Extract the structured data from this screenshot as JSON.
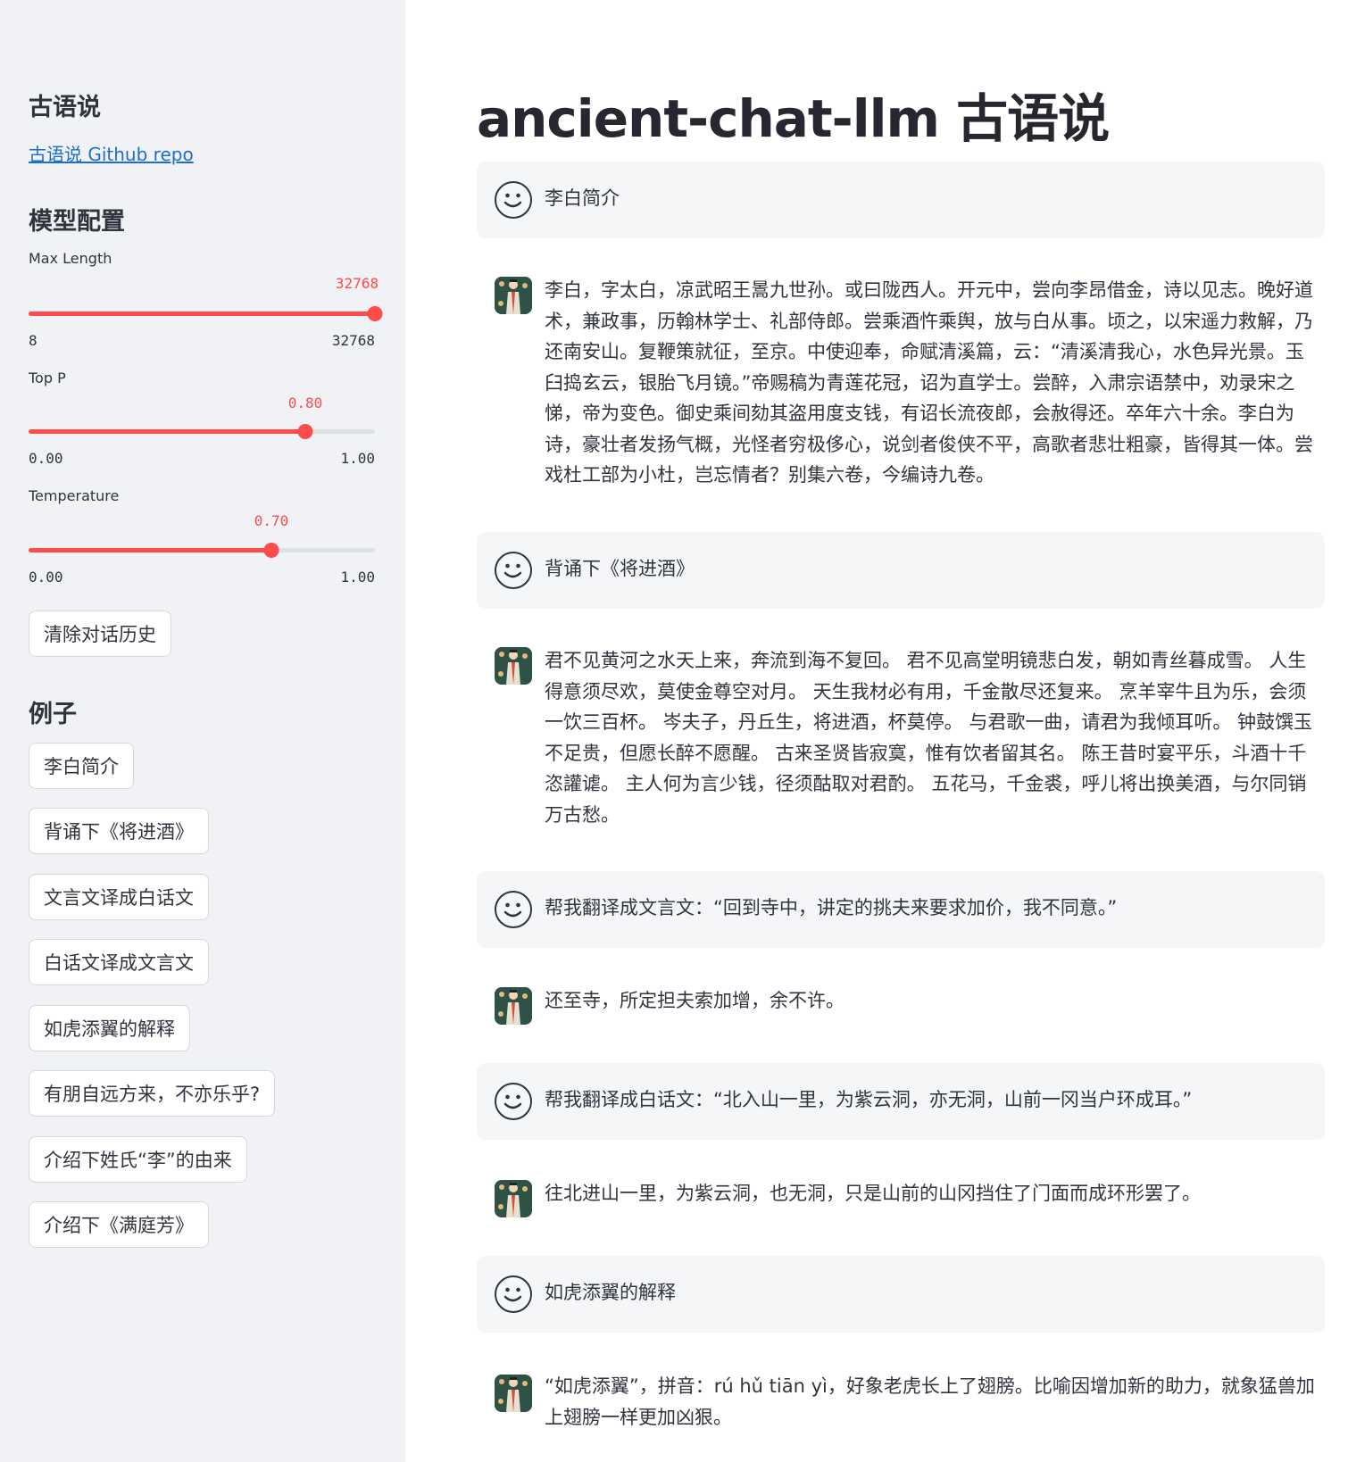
{
  "sidebar": {
    "title": "古语说",
    "repo_link": "古语说 Github repo",
    "model_config_heading": "模型配置",
    "sliders": [
      {
        "label": "Max Length",
        "value": "32768",
        "min": "8",
        "max": "32768",
        "fraction": 1.0
      },
      {
        "label": "Top P",
        "value": "0.80",
        "min": "0.00",
        "max": "1.00",
        "fraction": 0.8
      },
      {
        "label": "Temperature",
        "value": "0.70",
        "min": "0.00",
        "max": "1.00",
        "fraction": 0.7
      }
    ],
    "clear_button": "清除对话历史",
    "examples_heading": "例子",
    "examples": [
      "李白简介",
      "背诵下《将进酒》",
      "文言文译成白话文",
      "白话文译成文言文",
      "如虎添翼的解释",
      "有朋自远方来，不亦乐乎?",
      "介绍下姓氏“李”的由来",
      "介绍下《满庭芳》"
    ]
  },
  "main": {
    "title": "ancient-chat-llm 古语说",
    "messages": [
      {
        "role": "user",
        "text": "李白简介"
      },
      {
        "role": "assistant",
        "text": "李白，字太白，凉武昭王暠九世孙。或曰陇西人。开元中，尝向李昂借金，诗以见志。晚好道术，兼政事，历翰林学士、礼部侍郎。尝乘酒忤乘舆，放与白从事。顷之，以宋遥力救解，乃还南安山。复鞭策就征，至京。中使迎奉，命赋清溪篇，云：“清溪清我心，水色异光景。玉臼捣玄云，银胎飞月镜。”帝赐稿为青莲花冠，诏为直学士。尝醉，入肃宗语禁中，劝录宋之悌，帝为变色。御史乘间劾其盗用度支钱，有诏长流夜郎，会赦得还。卒年六十余。李白为诗，豪壮者发扬气概，光怪者穷极侈心，说剑者俊侠不平，高歌者悲壮粗豪，皆得其一体。尝戏杜工部为小杜，岂忘情者？别集六卷，今编诗九卷。"
      },
      {
        "role": "user",
        "text": "背诵下《将进酒》"
      },
      {
        "role": "assistant",
        "text": "君不见黄河之水天上来，奔流到海不复回。 君不见高堂明镜悲白发，朝如青丝暮成雪。 人生得意须尽欢，莫使金尊空对月。 天生我材必有用，千金散尽还复来。 烹羊宰牛且为乐，会须一饮三百杯。 岑夫子，丹丘生，将进酒，杯莫停。 与君歌一曲，请君为我倾耳听。 钟鼓馔玉不足贵，但愿长醉不愿醒。 古来圣贤皆寂寞，惟有饮者留其名。 陈王昔时宴平乐，斗酒十千恣讙谑。 主人何为言少钱，径须酤取对君酌。 五花马，千金裘，呼儿将出换美酒，与尔同销万古愁。"
      },
      {
        "role": "user",
        "text": "帮我翻译成文言文：“回到寺中，讲定的挑夫来要求加价，我不同意。”"
      },
      {
        "role": "assistant",
        "text": "还至寺，所定担夫索加增，余不许。"
      },
      {
        "role": "user",
        "text": "帮我翻译成白话文：“北入山一里，为紫云洞，亦无洞，山前一冈当户环成耳。”"
      },
      {
        "role": "assistant",
        "text": "往北进山一里，为紫云洞，也无洞，只是山前的山冈挡住了门面而成环形罢了。"
      },
      {
        "role": "user",
        "text": "如虎添翼的解释"
      },
      {
        "role": "assistant",
        "text": "“如虎添翼”，拼音：rú hǔ tiān yì，好象老虎长上了翅膀。比喻因增加新的助力，就象猛兽加上翅膀一样更加凶狠。"
      }
    ]
  },
  "colors": {
    "accent": "#ff4b4b",
    "sidebar_bg": "#f0f2f6",
    "link": "#1c6fd1",
    "user_msg_bg": "#f5f6f8"
  },
  "icons": {
    "user_avatar": "smiley-face-icon",
    "assistant_avatar": "ancient-figure-avatar-icon"
  }
}
